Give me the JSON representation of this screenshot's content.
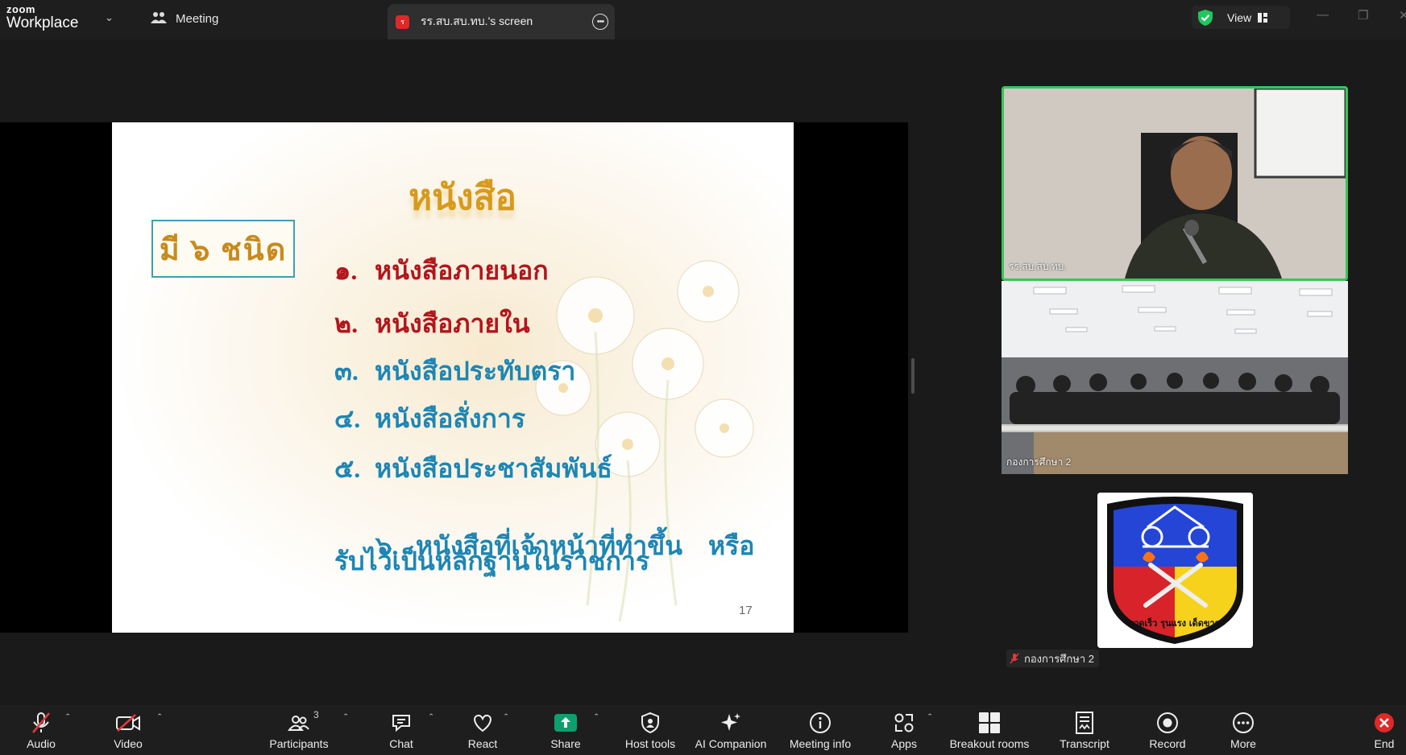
{
  "app": {
    "logo_top": "zoom",
    "logo_bottom": "Workplace"
  },
  "tabs": {
    "meeting": "Meeting",
    "screen": "รร.สบ.สบ.ทบ.'s screen",
    "screen_badge": "ร"
  },
  "view": {
    "label": "View",
    "secure_color": "#22c55e"
  },
  "slide": {
    "title": "หนังสือ",
    "box": "มี ๖ ชนิด",
    "items": [
      {
        "num": "๑.",
        "text": "หนังสือภายนอก"
      },
      {
        "num": "๒.",
        "text": "หนังสือภายใน"
      },
      {
        "num": "๓.",
        "text": "หนังสือประทับตรา"
      },
      {
        "num": "๔.",
        "text": "หนังสือสั่งการ"
      },
      {
        "num": "๕.",
        "text": "หนังสือประชาสัมพันธ์"
      },
      {
        "num": "๖.",
        "text": "หนังสือที่เจ้าหน้าที่ทำขึ้น    หรือ"
      }
    ],
    "item6_line2": "รับไว้เป็นหลักฐานในราชการ",
    "page": "17"
  },
  "participants": {
    "host_name": "รร.สบ.สบ.ทบ.",
    "room_name": "กองการศึกษา 2",
    "logo_name": "กองการศึกษา 2",
    "logo_motto": "รวดเร็ว รุนแรง เด็ดขาด"
  },
  "toolbar": {
    "audio": "Audio",
    "video": "Video",
    "participants": "Participants",
    "participant_count": "3",
    "chat": "Chat",
    "react": "React",
    "share": "Share",
    "host_tools": "Host tools",
    "ai_companion": "AI Companion",
    "meeting_info": "Meeting info",
    "apps": "Apps",
    "breakout_rooms": "Breakout rooms",
    "transcript": "Transcript",
    "record": "Record",
    "more": "More",
    "end": "End"
  },
  "colors": {
    "accent_green": "#34c759",
    "share_green": "#0e9f6e",
    "end_red": "#e02828"
  }
}
